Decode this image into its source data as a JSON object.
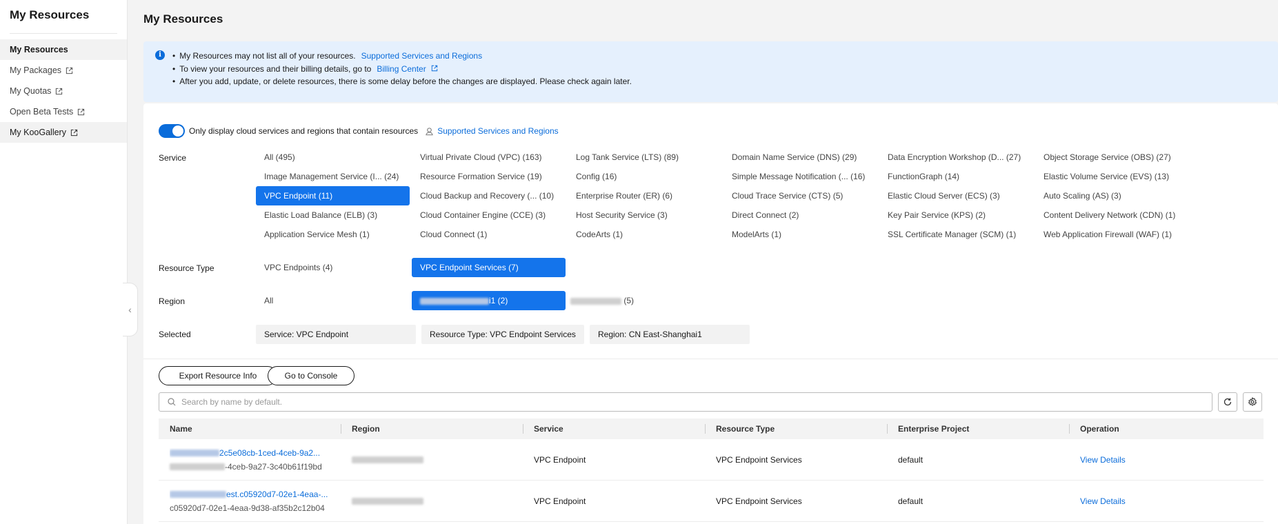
{
  "sidebar": {
    "title": "My Resources",
    "items": [
      {
        "label": "My Resources"
      },
      {
        "label": "My Packages"
      },
      {
        "label": "My Quotas"
      },
      {
        "label": "Open Beta Tests"
      },
      {
        "label": "My KooGallery"
      }
    ]
  },
  "page": {
    "title": "My Resources"
  },
  "notice": {
    "line1": "My Resources may not list all of your resources.",
    "line1_link": "Supported Services and Regions",
    "line2": "To view your resources and their billing details, go to",
    "line2_link": "Billing Center",
    "line3": "After you add, update, or delete resources, there is some delay before the changes are displayed. Please check again later."
  },
  "toggle": {
    "label": "Only display cloud services and regions that contain resources",
    "link": "Supported Services and Regions",
    "on": true
  },
  "filters": {
    "service_label": "Service",
    "resource_type_label": "Resource Type",
    "region_label": "Region",
    "selected_label": "Selected",
    "services": [
      "All (495)",
      "Virtual Private Cloud (VPC) (163)",
      "Log Tank Service (LTS) (89)",
      "Domain Name Service (DNS) (29)",
      "Data Encryption Workshop (D... (27)",
      "Object Storage Service (OBS) (27)",
      "Image Management Service (I... (24)",
      "Resource Formation Service (19)",
      "Config (16)",
      "Simple Message Notification (... (16)",
      "FunctionGraph (14)",
      "Elastic Volume Service (EVS) (13)",
      "VPC Endpoint (11)",
      "Cloud Backup and Recovery (... (10)",
      "Enterprise Router (ER) (6)",
      "Cloud Trace Service (CTS) (5)",
      "Elastic Cloud Server (ECS) (3)",
      "Auto Scaling (AS) (3)",
      "Elastic Load Balance (ELB) (3)",
      "Cloud Container Engine (CCE) (3)",
      "Host Security Service (3)",
      "Direct Connect (2)",
      "Key Pair Service (KPS) (2)",
      "Content Delivery Network (CDN) (1)",
      "Application Service Mesh (1)",
      "Cloud Connect (1)",
      "CodeArts (1)",
      "ModelArts (1)",
      "SSL Certificate Manager (SCM) (1)",
      "Web Application Firewall (WAF) (1)"
    ],
    "selected_service_index": 12,
    "resource_types": [
      "VPC Endpoints (4)",
      "VPC Endpoint Services (7)"
    ],
    "regions": {
      "all": "All",
      "region1_suffix": "i1 (2)",
      "region2_suffix": " (5)"
    },
    "selected_chips": [
      "Service: VPC Endpoint",
      "Resource Type: VPC Endpoint Services",
      "Region: CN East-Shanghai1"
    ]
  },
  "toolbar": {
    "export_label": "Export Resource Info",
    "console_label": "Go to Console",
    "search_placeholder": "Search by name by default."
  },
  "table": {
    "headers": [
      "Name",
      "Region",
      "Service",
      "Resource Type",
      "Enterprise Project",
      "Operation"
    ],
    "rows": [
      {
        "name_link": "2c5e08cb-1ced-4ceb-9a2...",
        "name_sub": "-4ceb-9a27-3c40b61f19bd",
        "service": "VPC Endpoint",
        "type": "VPC Endpoint Services",
        "project": "default",
        "op": "View Details"
      },
      {
        "name_link": "est.c05920d7-02e1-4eaa-...",
        "name_sub": "c05920d7-02e1-4eaa-9d38-af35b2c12b04",
        "service": "VPC Endpoint",
        "type": "VPC Endpoint Services",
        "project": "default",
        "op": "View Details"
      }
    ]
  }
}
